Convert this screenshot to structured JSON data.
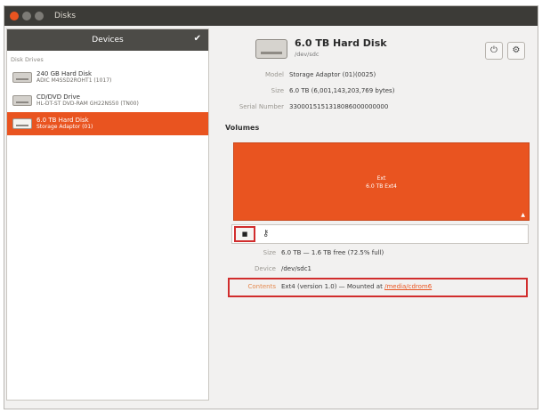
{
  "window": {
    "title": "Disks"
  },
  "sidebar": {
    "header": "Devices",
    "section_label": "Disk Drives",
    "items": [
      {
        "name": "240 GB Hard Disk",
        "sub": "ADIC M4SSD2ROHT1 (1017)"
      },
      {
        "name": "CD/DVD Drive",
        "sub": "HL-DT-ST DVD-RAM GH22NS50 (TN00)"
      },
      {
        "name": "6.0 TB Hard Disk",
        "sub": "Storage Adaptor (01)"
      }
    ]
  },
  "disk": {
    "title": "6.0 TB Hard Disk",
    "subtitle": "/dev/sdc",
    "properties": [
      {
        "label": "Model",
        "value": "Storage Adaptor (01)(0025)"
      },
      {
        "label": "Size",
        "value": "6.0 TB (6,001,143,203,769 bytes)"
      },
      {
        "label": "Serial Number",
        "value": "3300015151318086000000000"
      }
    ]
  },
  "volumes": {
    "label": "Volumes",
    "bar_line1": "Ext",
    "bar_line2": "6.0 TB Ext4",
    "power_button_label": "■",
    "key_label": "⚷",
    "details": [
      {
        "label": "Size",
        "value": "6.0 TB — 1.6 TB free (72.5% full)"
      },
      {
        "label": "Device",
        "value": "/dev/sdc1"
      },
      {
        "label": "Contents",
        "value": "Ext4 (version 1.0) — Mounted at",
        "link": "/media/cdrom6"
      }
    ]
  }
}
